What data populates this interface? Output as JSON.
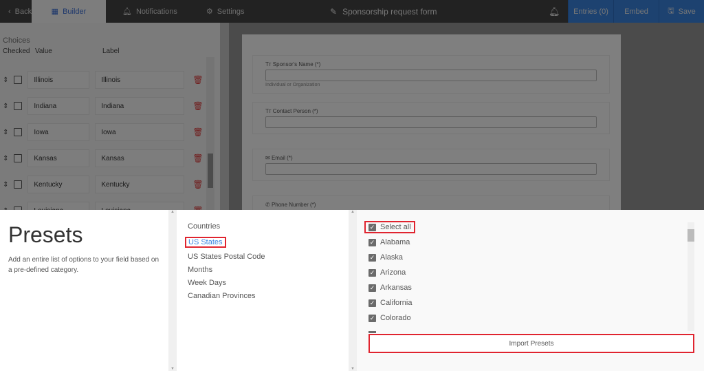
{
  "topbar": {
    "back": "Back",
    "builder": "Builder",
    "notifications": "Notifications",
    "settings": "Settings",
    "form_title": "Sponsorship request form",
    "entries": "Entries (0)",
    "embed": "Embed",
    "save": "Save"
  },
  "choices": {
    "title": "Choices",
    "col_checked": "Checked",
    "col_value": "Value",
    "col_label": "Label",
    "rows": [
      {
        "value": "Illinois",
        "label": "Illinois"
      },
      {
        "value": "Indiana",
        "label": "Indiana"
      },
      {
        "value": "Iowa",
        "label": "Iowa"
      },
      {
        "value": "Kansas",
        "label": "Kansas"
      },
      {
        "value": "Kentucky",
        "label": "Kentucky"
      },
      {
        "value": "Louisiana",
        "label": "Louisiana"
      }
    ]
  },
  "form": {
    "fields": [
      {
        "label": "Sponsor's Name (*)",
        "help": "Individual or Organization"
      },
      {
        "label": "Contact Person (*)"
      },
      {
        "label": "Email (*)"
      },
      {
        "label": "Phone Number (*)"
      }
    ]
  },
  "presets": {
    "title": "Presets",
    "description": "Add an entire list of options to your field based on a pre-defined category.",
    "categories": [
      "Countries",
      "US States",
      "US States Postal Code",
      "Months",
      "Week Days",
      "Canadian Provinces"
    ],
    "selected_category": "US States",
    "select_all": "Select all",
    "options": [
      "Alabama",
      "Alaska",
      "Arizona",
      "Arkansas",
      "California",
      "Colorado"
    ],
    "import_button": "Import Presets"
  },
  "colors": {
    "accent": "#3a84e0",
    "highlight": "#e0242f",
    "delete": "#e03b3b"
  }
}
